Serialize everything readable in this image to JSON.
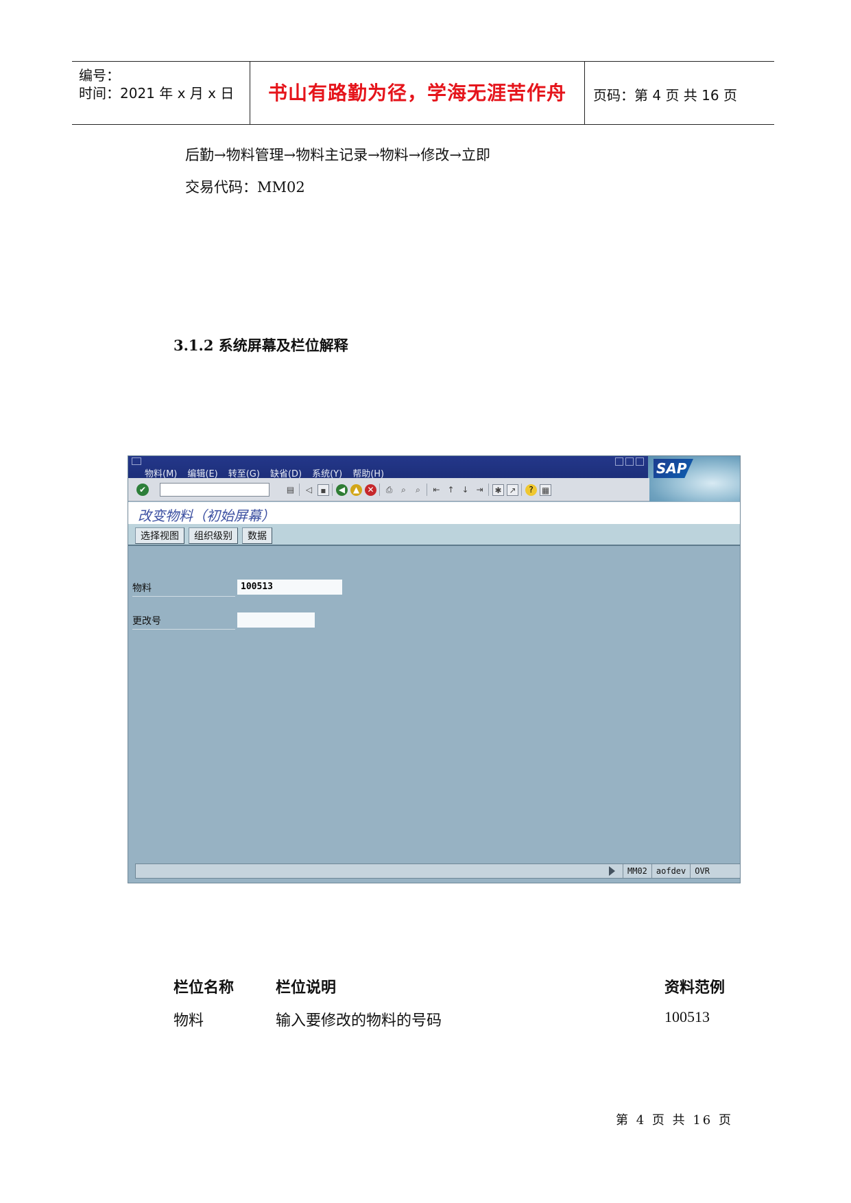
{
  "header": {
    "number_label": "编号：",
    "time_label": "时间：2021 年 x 月 x 日",
    "motto": "书山有路勤为径，学海无涯苦作舟",
    "page_label": "页码：第 4 页  共 16 页"
  },
  "body": {
    "menu_path": "后勤→物料管理→物料主记录→物料→修改→立即",
    "tcode_line": "交易代码：MM02",
    "section_title": "3.1.2 系统屏幕及栏位解释"
  },
  "sap": {
    "menu": [
      "物料(M)",
      "编辑(E)",
      "转至(G)",
      "缺省(D)",
      "系统(Y)",
      "帮助(H)"
    ],
    "logo": "SAP",
    "title": "改变物料（初始屏幕）",
    "app_buttons": [
      "选择视图",
      "组织级别",
      "数据"
    ],
    "fields": {
      "material_label": "物料",
      "material_value": "100513",
      "change_no_label": "更改号",
      "change_no_value": ""
    },
    "status": {
      "tcode": "MM02",
      "server": "aofdev",
      "mode": "OVR"
    }
  },
  "table": {
    "headers": [
      "栏位名称",
      "栏位说明",
      "资料范例"
    ],
    "rows": [
      [
        "物料",
        "输入要修改的物料的号码",
        "100513"
      ]
    ]
  },
  "footer": {
    "page_text": "第 4 页 共 16 页"
  }
}
